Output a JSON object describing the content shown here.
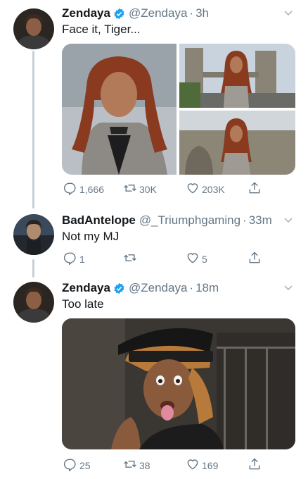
{
  "tweets": [
    {
      "name": "Zendaya",
      "handle": "@Zendaya",
      "time": "3h",
      "text": "Face it, Tiger...",
      "verified": true,
      "replies": "1,666",
      "retweets": "30K",
      "likes": "203K"
    },
    {
      "name": "BadAntelope",
      "handle": "@_Triumphgaming",
      "time": "33m",
      "text": "Not my MJ",
      "verified": false,
      "replies": "1",
      "retweets": "",
      "likes": "5"
    },
    {
      "name": "Zendaya",
      "handle": "@Zendaya",
      "time": "18m",
      "text": "Too late",
      "verified": true,
      "replies": "25",
      "retweets": "38",
      "likes": "169"
    }
  ],
  "icons": {
    "reply": "reply-icon",
    "retweet": "retweet-icon",
    "like": "heart-icon",
    "share": "share-icon",
    "caret": "chevron-down-icon",
    "verified": "verified-badge-icon"
  },
  "colors": {
    "verified": "#1da1f2",
    "secondary_text": "#657786",
    "thread_line": "#c4cfd6"
  }
}
